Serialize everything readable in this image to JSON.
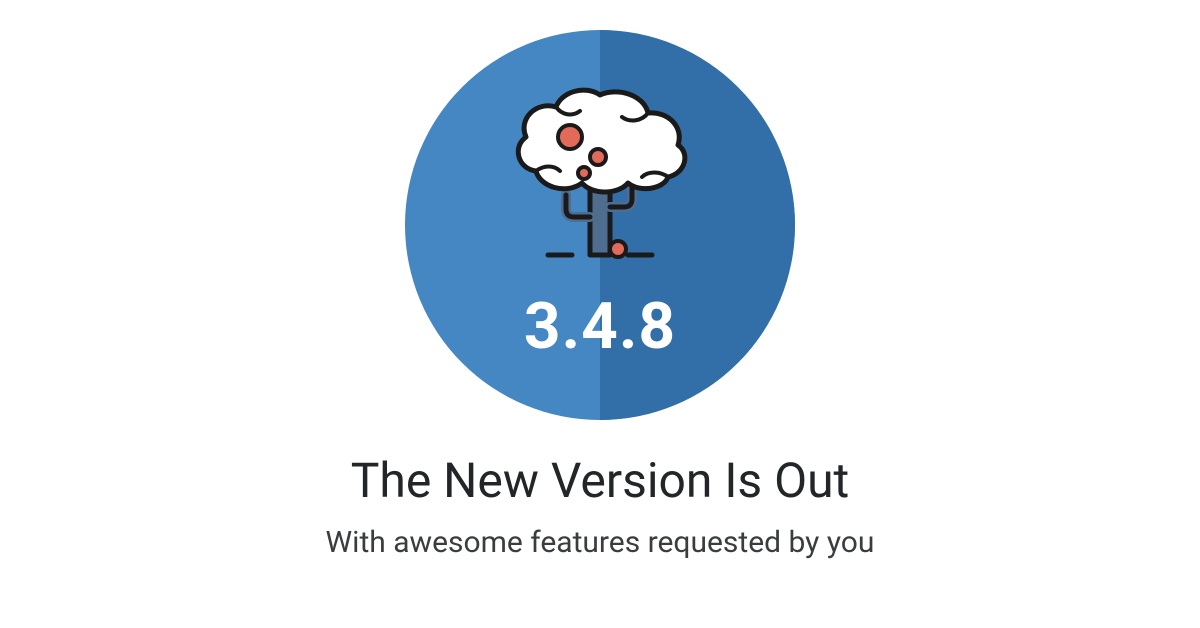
{
  "badge": {
    "version": "3.4.8",
    "icon_name": "tree-icon",
    "circle_color_left": "#4587c2",
    "circle_color_right": "#326fa8",
    "fruit_color": "#e26a5a",
    "trunk_color": "#4f6d8f",
    "canopy_color": "#ffffff"
  },
  "headline": {
    "title": "The New Version Is Out",
    "subtitle": "With awesome features requested by you"
  }
}
